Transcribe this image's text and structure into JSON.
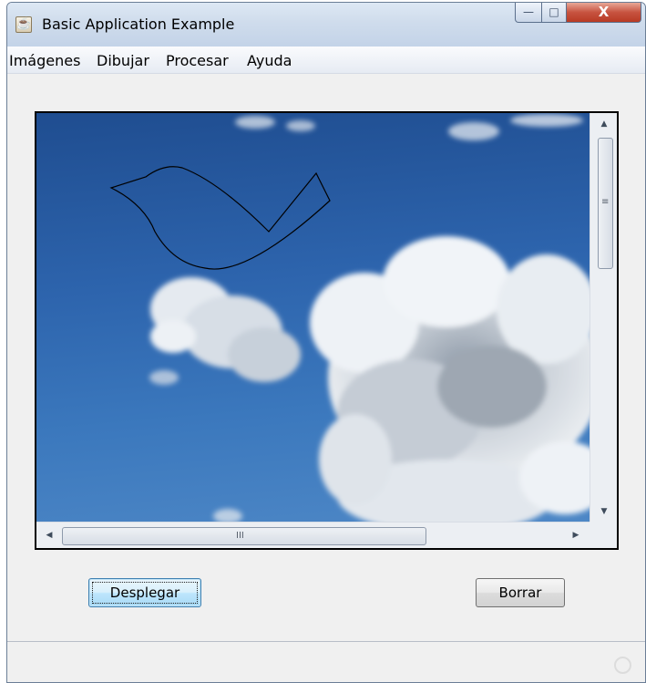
{
  "window": {
    "title": "Basic Application Example",
    "icon": "java-cup-icon",
    "controls": {
      "minimize_glyph": "—",
      "maximize_glyph": "□",
      "close_glyph": "X"
    }
  },
  "menubar": {
    "items": [
      {
        "label": "Imágenes"
      },
      {
        "label": "Dibujar"
      },
      {
        "label": "Procesar"
      },
      {
        "label": "Ayuda"
      }
    ]
  },
  "canvas": {
    "image": "sky-with-clouds",
    "drawing": "bird-outline",
    "sky_color": "#2d64ad",
    "stroke_color": "#000000"
  },
  "scrollbars": {
    "up_arrow": "▲",
    "down_arrow": "▼",
    "left_arrow": "◀",
    "right_arrow": "▶",
    "vertical_grip": "≡",
    "horizontal_grip": "III"
  },
  "buttons": {
    "desplegar": "Desplegar",
    "borrar": "Borrar"
  },
  "colors": {
    "close_button": "#c75340",
    "focused_button": "#bee6fd",
    "window_background": "#f0f0f0"
  }
}
